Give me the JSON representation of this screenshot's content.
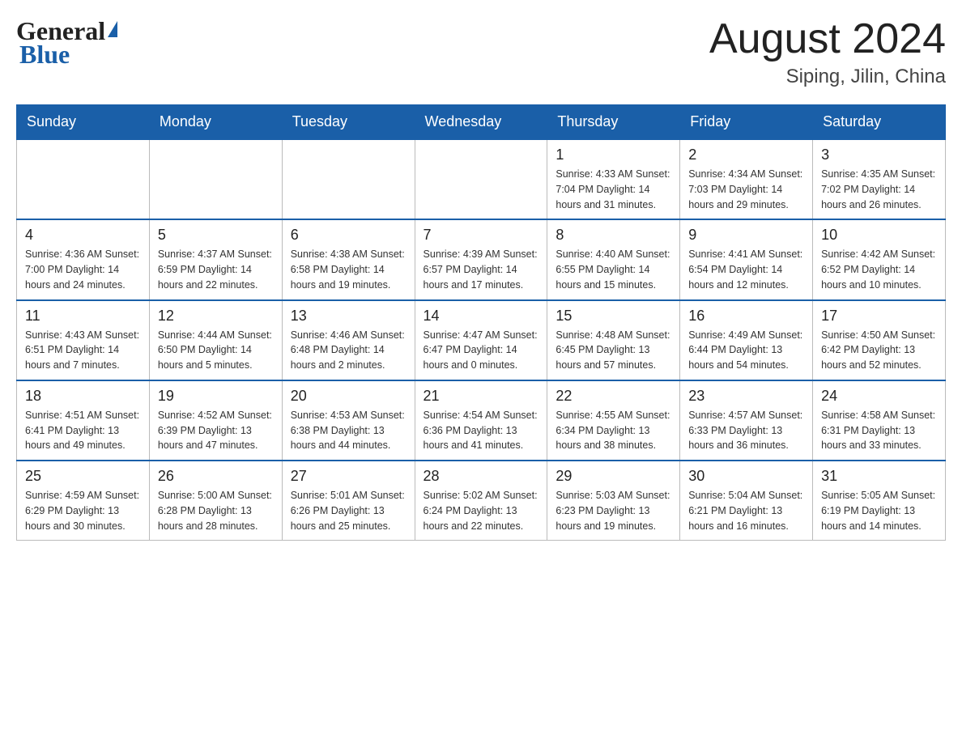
{
  "header": {
    "logo_general": "General",
    "logo_blue": "Blue",
    "month_title": "August 2024",
    "location": "Siping, Jilin, China"
  },
  "days_of_week": [
    "Sunday",
    "Monday",
    "Tuesday",
    "Wednesday",
    "Thursday",
    "Friday",
    "Saturday"
  ],
  "weeks": [
    [
      {
        "day": "",
        "info": ""
      },
      {
        "day": "",
        "info": ""
      },
      {
        "day": "",
        "info": ""
      },
      {
        "day": "",
        "info": ""
      },
      {
        "day": "1",
        "info": "Sunrise: 4:33 AM\nSunset: 7:04 PM\nDaylight: 14 hours\nand 31 minutes."
      },
      {
        "day": "2",
        "info": "Sunrise: 4:34 AM\nSunset: 7:03 PM\nDaylight: 14 hours\nand 29 minutes."
      },
      {
        "day": "3",
        "info": "Sunrise: 4:35 AM\nSunset: 7:02 PM\nDaylight: 14 hours\nand 26 minutes."
      }
    ],
    [
      {
        "day": "4",
        "info": "Sunrise: 4:36 AM\nSunset: 7:00 PM\nDaylight: 14 hours\nand 24 minutes."
      },
      {
        "day": "5",
        "info": "Sunrise: 4:37 AM\nSunset: 6:59 PM\nDaylight: 14 hours\nand 22 minutes."
      },
      {
        "day": "6",
        "info": "Sunrise: 4:38 AM\nSunset: 6:58 PM\nDaylight: 14 hours\nand 19 minutes."
      },
      {
        "day": "7",
        "info": "Sunrise: 4:39 AM\nSunset: 6:57 PM\nDaylight: 14 hours\nand 17 minutes."
      },
      {
        "day": "8",
        "info": "Sunrise: 4:40 AM\nSunset: 6:55 PM\nDaylight: 14 hours\nand 15 minutes."
      },
      {
        "day": "9",
        "info": "Sunrise: 4:41 AM\nSunset: 6:54 PM\nDaylight: 14 hours\nand 12 minutes."
      },
      {
        "day": "10",
        "info": "Sunrise: 4:42 AM\nSunset: 6:52 PM\nDaylight: 14 hours\nand 10 minutes."
      }
    ],
    [
      {
        "day": "11",
        "info": "Sunrise: 4:43 AM\nSunset: 6:51 PM\nDaylight: 14 hours\nand 7 minutes."
      },
      {
        "day": "12",
        "info": "Sunrise: 4:44 AM\nSunset: 6:50 PM\nDaylight: 14 hours\nand 5 minutes."
      },
      {
        "day": "13",
        "info": "Sunrise: 4:46 AM\nSunset: 6:48 PM\nDaylight: 14 hours\nand 2 minutes."
      },
      {
        "day": "14",
        "info": "Sunrise: 4:47 AM\nSunset: 6:47 PM\nDaylight: 14 hours\nand 0 minutes."
      },
      {
        "day": "15",
        "info": "Sunrise: 4:48 AM\nSunset: 6:45 PM\nDaylight: 13 hours\nand 57 minutes."
      },
      {
        "day": "16",
        "info": "Sunrise: 4:49 AM\nSunset: 6:44 PM\nDaylight: 13 hours\nand 54 minutes."
      },
      {
        "day": "17",
        "info": "Sunrise: 4:50 AM\nSunset: 6:42 PM\nDaylight: 13 hours\nand 52 minutes."
      }
    ],
    [
      {
        "day": "18",
        "info": "Sunrise: 4:51 AM\nSunset: 6:41 PM\nDaylight: 13 hours\nand 49 minutes."
      },
      {
        "day": "19",
        "info": "Sunrise: 4:52 AM\nSunset: 6:39 PM\nDaylight: 13 hours\nand 47 minutes."
      },
      {
        "day": "20",
        "info": "Sunrise: 4:53 AM\nSunset: 6:38 PM\nDaylight: 13 hours\nand 44 minutes."
      },
      {
        "day": "21",
        "info": "Sunrise: 4:54 AM\nSunset: 6:36 PM\nDaylight: 13 hours\nand 41 minutes."
      },
      {
        "day": "22",
        "info": "Sunrise: 4:55 AM\nSunset: 6:34 PM\nDaylight: 13 hours\nand 38 minutes."
      },
      {
        "day": "23",
        "info": "Sunrise: 4:57 AM\nSunset: 6:33 PM\nDaylight: 13 hours\nand 36 minutes."
      },
      {
        "day": "24",
        "info": "Sunrise: 4:58 AM\nSunset: 6:31 PM\nDaylight: 13 hours\nand 33 minutes."
      }
    ],
    [
      {
        "day": "25",
        "info": "Sunrise: 4:59 AM\nSunset: 6:29 PM\nDaylight: 13 hours\nand 30 minutes."
      },
      {
        "day": "26",
        "info": "Sunrise: 5:00 AM\nSunset: 6:28 PM\nDaylight: 13 hours\nand 28 minutes."
      },
      {
        "day": "27",
        "info": "Sunrise: 5:01 AM\nSunset: 6:26 PM\nDaylight: 13 hours\nand 25 minutes."
      },
      {
        "day": "28",
        "info": "Sunrise: 5:02 AM\nSunset: 6:24 PM\nDaylight: 13 hours\nand 22 minutes."
      },
      {
        "day": "29",
        "info": "Sunrise: 5:03 AM\nSunset: 6:23 PM\nDaylight: 13 hours\nand 19 minutes."
      },
      {
        "day": "30",
        "info": "Sunrise: 5:04 AM\nSunset: 6:21 PM\nDaylight: 13 hours\nand 16 minutes."
      },
      {
        "day": "31",
        "info": "Sunrise: 5:05 AM\nSunset: 6:19 PM\nDaylight: 13 hours\nand 14 minutes."
      }
    ]
  ]
}
